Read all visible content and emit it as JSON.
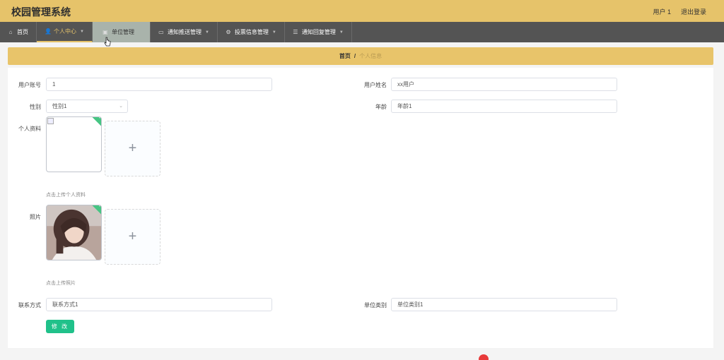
{
  "header": {
    "title": "校园管理系统",
    "user": "用户 1",
    "logout": "退出登录"
  },
  "nav": {
    "items": [
      {
        "label": "首页",
        "icon": "home-icon"
      },
      {
        "label": "个人中心",
        "icon": "user-icon"
      },
      {
        "label": "单位管理",
        "icon": "monitor-icon"
      },
      {
        "label": "通知推送管理",
        "icon": "monitor-icon"
      },
      {
        "label": "投票信息管理",
        "icon": "gear-icon"
      },
      {
        "label": "通知回复管理",
        "icon": "list-icon"
      }
    ]
  },
  "breadcrumb": {
    "home": "首页",
    "separator": "/",
    "current": "个人信息"
  },
  "form": {
    "account_label": "用户账号",
    "account_value": "1",
    "name_label": "用户姓名",
    "name_value": "xx用户",
    "gender_label": "性别",
    "gender_value": "性别1",
    "age_label": "年龄",
    "age_value": "年龄1",
    "profile_label": "个人资料",
    "profile_hint": "点击上传个人资料",
    "photo_label": "照片",
    "photo_hint": "点击上传照片",
    "contact_label": "联系方式",
    "contact_value": "联系方式1",
    "unit_type_label": "单位类别",
    "unit_type_value": "单位类别1",
    "submit_label": "修 改"
  },
  "colors": {
    "header_bg": "#e6c36a",
    "nav_bg": "#545454",
    "button_bg": "#20c18a"
  }
}
